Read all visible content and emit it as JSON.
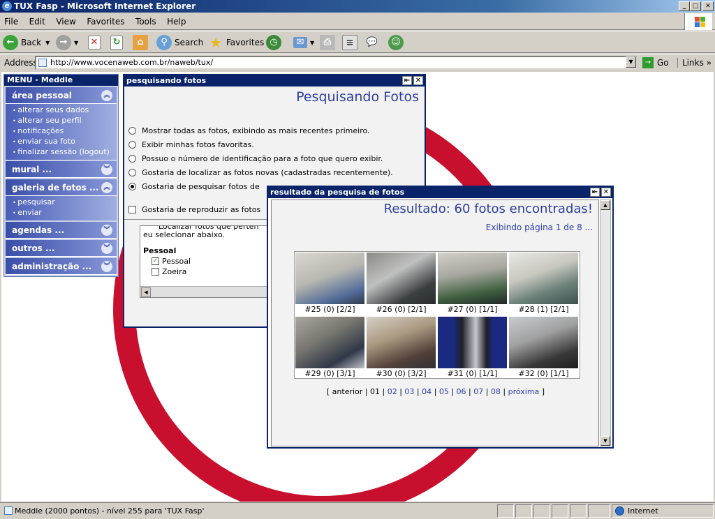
{
  "window": {
    "title": "TUX Fasp - Microsoft Internet Explorer"
  },
  "menubar": [
    "File",
    "Edit",
    "View",
    "Favorites",
    "Tools",
    "Help"
  ],
  "toolbar": {
    "back": "Back",
    "search": "Search",
    "favorites": "Favorites"
  },
  "address": {
    "label": "Address",
    "url": "http://www.vocenaweb.com.br/naweb/tux/",
    "go": "Go",
    "links": "Links"
  },
  "status": {
    "text": "Meddle (2000 pontos) - nível 255 para 'TUX Fasp'",
    "zone": "Internet"
  },
  "menu": {
    "title": "MENU - Meddle",
    "sections": [
      {
        "label": "área pessoal",
        "items": [
          "alterar seus dados",
          "alterar seu perfil",
          "notificações",
          "enviar sua foto",
          "finalizar sessão (logout)"
        ]
      },
      {
        "label": "mural ..."
      },
      {
        "label": "galeria de fotos ...",
        "items": [
          "pesquisar",
          "enviar"
        ]
      },
      {
        "label": "agendas ..."
      },
      {
        "label": "outros ..."
      },
      {
        "label": "administração ..."
      }
    ]
  },
  "search_window": {
    "title": "pesquisando fotos",
    "heading": "Pesquisando Fotos",
    "options": [
      "Mostrar todas as fotos, exibindo as mais recentes primeiro.",
      "Exibir minhas fotos favoritas.",
      "Possuo o número de identificação para a foto que quero exibir.",
      "Gostaria de localizar as fotos novas (cadastradas recentemente).",
      "Gostaria de pesquisar fotos de"
    ],
    "checkbox_option": "Gostaria de reproduzir as fotos",
    "box_text1": "Localizar fotos que perten",
    "box_text2": "eu selecionar abaixo.",
    "group_label": "Pessoal",
    "group_items": [
      "Pessoal",
      "Zoeira"
    ]
  },
  "result_window": {
    "title": "resultado da pesquisa de fotos",
    "heading": "Resultado: 60 fotos encontradas!",
    "subheading": "Exibindo página 1 de 8 ...",
    "photos": [
      "#25 (0) [2/2]",
      "#26 (0) [2/1]",
      "#27 (0) [1/1]",
      "#28 (1) [2/1]",
      "#29 (0) [3/1]",
      "#30 (0) [3/2]",
      "#31 (0) [1/1]",
      "#32 (0) [1/1]"
    ],
    "pager": {
      "prev": "[ anterior",
      "current": "01",
      "pages": [
        "02",
        "03",
        "04",
        "05",
        "06",
        "07",
        "08"
      ],
      "next": "próxima"
    }
  },
  "colors": {
    "accent": "#0a246a",
    "ring": "#c8102e",
    "link": "#2a3ea8"
  }
}
